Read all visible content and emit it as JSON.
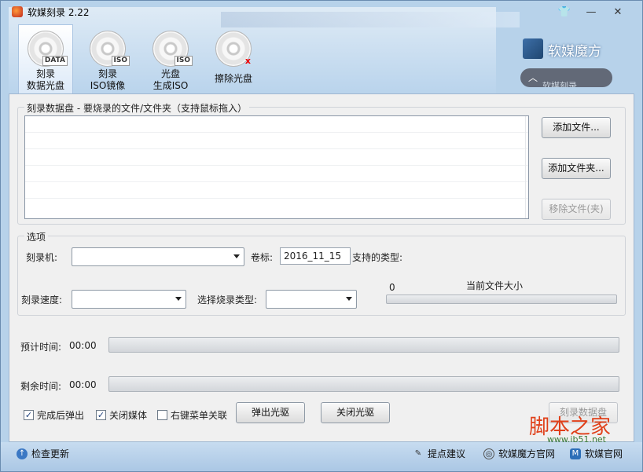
{
  "window": {
    "title": "软媒刻录 2.22",
    "controls": {
      "skin": "👕",
      "minimize": "—",
      "close": "✕"
    }
  },
  "toolbar": {
    "items": [
      {
        "line1": "刻录",
        "line2": "数据光盘",
        "tag": "DATA"
      },
      {
        "line1": "刻录",
        "line2": "ISO镜像",
        "tag": "ISO"
      },
      {
        "line1": "光盘",
        "line2": "生成ISO",
        "tag": "ISO"
      },
      {
        "line1": "擦除光盘",
        "line2": "",
        "tag": "x"
      }
    ],
    "brand": "软媒魔方",
    "collapse_text": "软媒刻录"
  },
  "burn_group": {
    "legend": "刻录数据盘 - 要烧录的文件/文件夹（支持鼠标拖入）",
    "add_file": "添加文件...",
    "add_folder": "添加文件夹...",
    "remove_file": "移除文件(夹)"
  },
  "options": {
    "legend": "选项",
    "burner_label": "刻录机:",
    "volume_label": "卷标:",
    "volume_value": "2016_11_15",
    "types_label": "支持的类型:",
    "speed_label": "刻录速度:",
    "burn_type_label": "选择烧录类型:",
    "size_value": "0",
    "size_label": "当前文件大小",
    "size_fraction": 0
  },
  "progress": {
    "estimated_label": "预计时间:",
    "estimated_value": "00:00",
    "estimated_fraction": 0,
    "remaining_label": "剩余时间:",
    "remaining_value": "00:00",
    "remaining_fraction": 0
  },
  "checkboxes": [
    {
      "label": "完成后弹出",
      "checked": true,
      "mark": "✓"
    },
    {
      "label": "关闭媒体",
      "checked": true,
      "mark": "✓"
    },
    {
      "label": "右键菜单关联",
      "checked": false,
      "mark": ""
    }
  ],
  "buttons": {
    "eject": "弹出光驱",
    "close_drive": "关闭光驱",
    "burn": "刻录数据盘"
  },
  "statusbar": {
    "check_update": "检查更新",
    "suggest": "提点建议",
    "mofang_site": "软媒魔方官网",
    "ruanmei_site": "软媒官网"
  },
  "watermark": {
    "main": "脚本之家",
    "sub": "www.jb51.net"
  }
}
